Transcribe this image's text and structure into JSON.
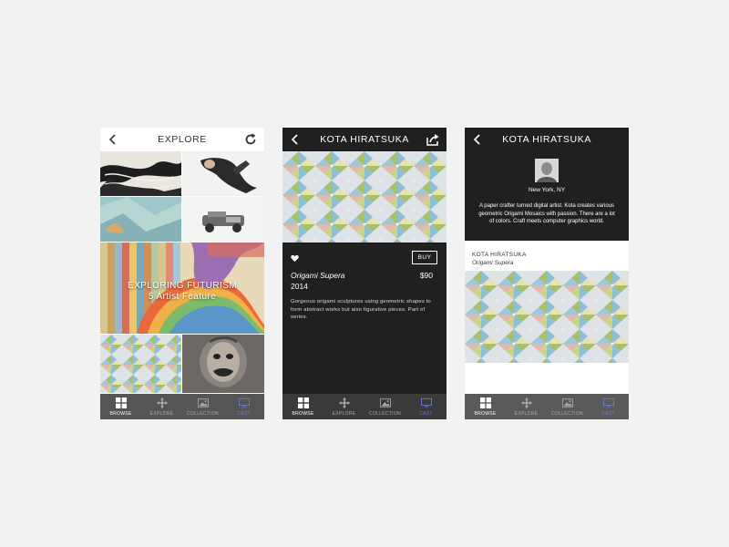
{
  "explore": {
    "title": "EXPLORE",
    "feature_line1": "EXPLORING FUTURISM",
    "feature_line2": "5 Artist Feature",
    "icons": {
      "back": "chevron-left-icon",
      "refresh": "refresh-icon"
    }
  },
  "artwork_detail": {
    "artist": "KOTA HIRATSUKA",
    "buy_label": "BUY",
    "title": "Origami Supera",
    "year": "2014",
    "price": "$90",
    "description": "Gorgeous origami sculptures using geometric shapes to form abstract works but also figurative pieces. Part of series.",
    "icons": {
      "back": "chevron-left-icon",
      "share": "share-icon",
      "favorite": "heart-icon"
    }
  },
  "artist_profile": {
    "name": "KOTA HIRATSUKA",
    "location": "New York, NY",
    "bio": "A paper crafter turned digital artist.  Kota creates various geometric Origami Mosaics with passion. There are a lot of colors. Craft meets computer graphics world.",
    "work_artist": "KOTA HIRATSUKA",
    "work_title": "Origami Supera"
  },
  "nav": [
    {
      "label": "BROWSE",
      "icon": "grid-icon"
    },
    {
      "label": "EXPLORE",
      "icon": "move-icon"
    },
    {
      "label": "COLLECTION",
      "icon": "image-icon"
    },
    {
      "label": "CAST",
      "icon": "monitor-icon"
    }
  ],
  "colors": {
    "background": "#f2f2f2",
    "dark_panel": "#202020",
    "nav_bar": "#555555",
    "cast_accent": "#6d7bd6"
  }
}
